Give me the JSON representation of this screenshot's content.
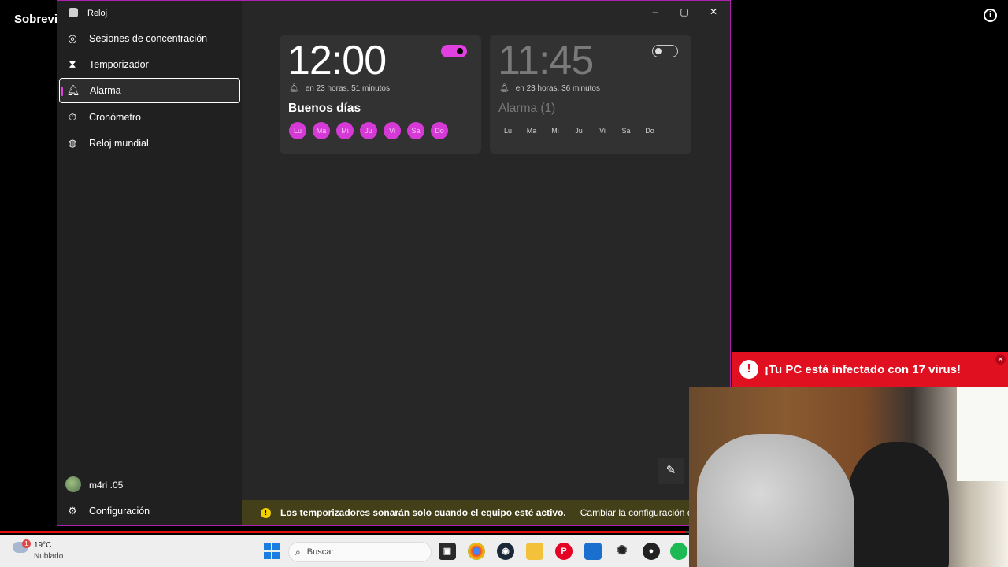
{
  "background": {
    "video_title": "Sobrevi"
  },
  "window": {
    "title": "Reloj",
    "controls": {
      "minimize": "–",
      "maximize": "▢",
      "close": "✕"
    }
  },
  "sidebar": {
    "items": [
      {
        "label": "Sesiones de concentración",
        "icon": "focus-icon"
      },
      {
        "label": "Temporizador",
        "icon": "hourglass-icon"
      },
      {
        "label": "Alarma",
        "icon": "bell-icon"
      },
      {
        "label": "Cronómetro",
        "icon": "stopwatch-icon"
      },
      {
        "label": "Reloj mundial",
        "icon": "globe-icon"
      }
    ],
    "user": {
      "name": "m4ri .05"
    },
    "settings_label": "Configuración"
  },
  "alarms": [
    {
      "time": "12:00",
      "remaining": "en 23 horas, 51 minutos",
      "name": "Buenos días",
      "enabled": true,
      "days": [
        "Lu",
        "Ma",
        "Mi",
        "Ju",
        "Vi",
        "Sa",
        "Do"
      ]
    },
    {
      "time": "11:45",
      "remaining": "en 23 horas, 36 minutos",
      "name": "Alarma (1)",
      "enabled": false,
      "days": [
        "Lu",
        "Ma",
        "Mi",
        "Ju",
        "Vi",
        "Sa",
        "Do"
      ]
    }
  ],
  "infobar": {
    "message": "Los temporizadores sonarán solo cuando el equipo esté activo.",
    "link": "Cambiar la configuración de ener"
  },
  "popup": {
    "text": "¡Tu PC está infectado con 17 virus!"
  },
  "video": {
    "progress": 0.68
  },
  "taskbar": {
    "weather": {
      "temp": "19°C",
      "desc": "Nublado",
      "badge": "1"
    },
    "search_placeholder": "Buscar"
  },
  "colors": {
    "accent": "#e040e0",
    "alert_red": "#e01020",
    "infobar": "#433f19"
  }
}
